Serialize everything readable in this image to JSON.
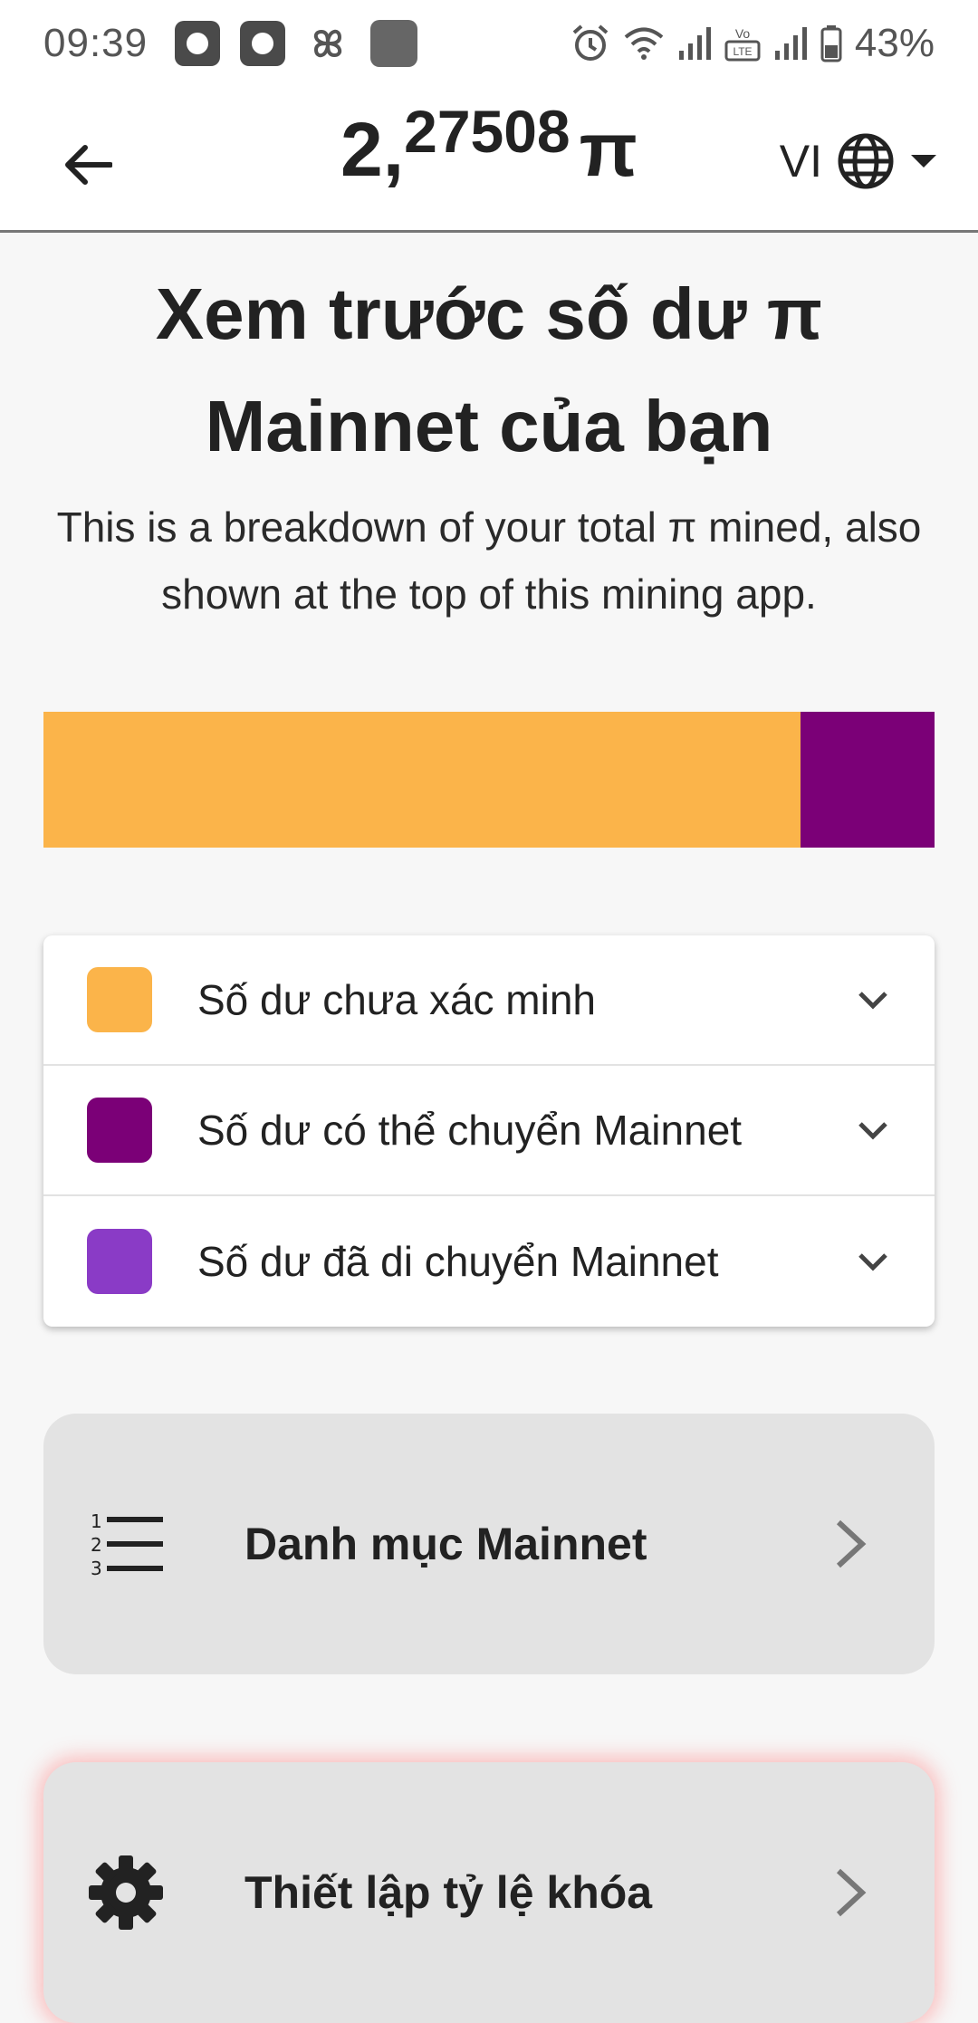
{
  "status_bar": {
    "time": "09:39",
    "battery": "43%",
    "icons": [
      "app-notification-icon",
      "app-notification-icon",
      "pinwheel-icon",
      "app-notification-icon",
      "alarm-icon",
      "wifi-icon",
      "signal-icon",
      "volte-icon",
      "signal-icon",
      "battery-icon"
    ],
    "volte_label": "Vo LTE"
  },
  "header": {
    "balance_integer": "2,",
    "balance_decimal": "27508",
    "balance_symbol": "π",
    "language": "VI",
    "icons": [
      "back-arrow-icon",
      "globe-icon",
      "dropdown-caret-icon"
    ]
  },
  "main": {
    "title": "Xem trước số dư π Mainnet của bạn",
    "subtitle": "This is a breakdown of your total π mined, also shown at the top of this mining app.",
    "bar": {
      "segments": [
        {
          "name": "Số dư chưa xác minh",
          "fraction": 0.85,
          "color": "#fbb44a"
        },
        {
          "name": "Số dư có thể chuyển Mainnet",
          "fraction": 0.15,
          "color": "#7b0077"
        }
      ]
    },
    "legend": [
      {
        "label": "Số dư chưa xác minh",
        "color": "#fbb44a"
      },
      {
        "label": "Số dư có thể chuyển Mainnet",
        "color": "#7b0077"
      },
      {
        "label": "Số dư đã di chuyển Mainnet",
        "color": "#8a3bc6"
      }
    ],
    "catalog_card": {
      "label": "Danh mục Mainnet",
      "icon": "numbered-list-icon"
    },
    "lock_card": {
      "label": "Thiết lập tỷ lệ khóa",
      "icon": "gear-icon"
    }
  }
}
